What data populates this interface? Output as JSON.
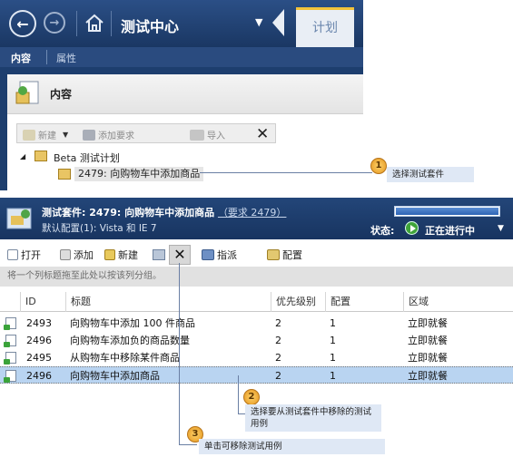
{
  "nav": {
    "title": "测试中心",
    "tab": "计划"
  },
  "subtabs": {
    "content": "内容",
    "properties": "属性"
  },
  "content_panel": {
    "heading": "内容",
    "toolbar": {
      "new": "新建",
      "add_requirements": "添加要求",
      "import": "导入"
    },
    "tree": {
      "root": "Beta 测试计划",
      "child": "2479: 向购物车中添加商品"
    }
  },
  "suite": {
    "title_prefix": "测试套件:",
    "title": "2479: 向购物车中添加商品",
    "requirement_link": "（要求 2479）",
    "default_config": "默认配置(1): Vista 和 IE 7",
    "state_label": "状态:",
    "state_value": "正在进行中",
    "progress": 1.0
  },
  "actions": {
    "open": "打开",
    "add": "添加",
    "new": "新建",
    "assign": "指派",
    "configure": "配置"
  },
  "group_hint": "将一个列标题拖至此处以按该列分组。",
  "grid": {
    "columns": [
      "ID",
      "标题",
      "优先级别",
      "配置",
      "区域"
    ],
    "rows": [
      {
        "id": "2493",
        "title": "向购物车中添加 100 件商品",
        "priority": "2",
        "config": "1",
        "area": "立即就餐"
      },
      {
        "id": "2496",
        "title": "向购物车添加负的商品数量",
        "priority": "2",
        "config": "1",
        "area": "立即就餐"
      },
      {
        "id": "2495",
        "title": "从购物车中移除某件商品",
        "priority": "2",
        "config": "1",
        "area": "立即就餐"
      },
      {
        "id": "2496",
        "title": "向购物车中添加商品",
        "priority": "2",
        "config": "1",
        "area": "立即就餐"
      }
    ]
  },
  "callouts": [
    {
      "number": "1",
      "text": "选择测试套件"
    },
    {
      "number": "2",
      "text": "选择要从测试套件中移除的测试用例"
    },
    {
      "number": "3",
      "text": "单击可移除测试用例"
    }
  ],
  "colors": {
    "nav_blue": "#1d3e6e",
    "selected_row": "#b9d4f1",
    "tab_accent": "#f3c33a"
  }
}
